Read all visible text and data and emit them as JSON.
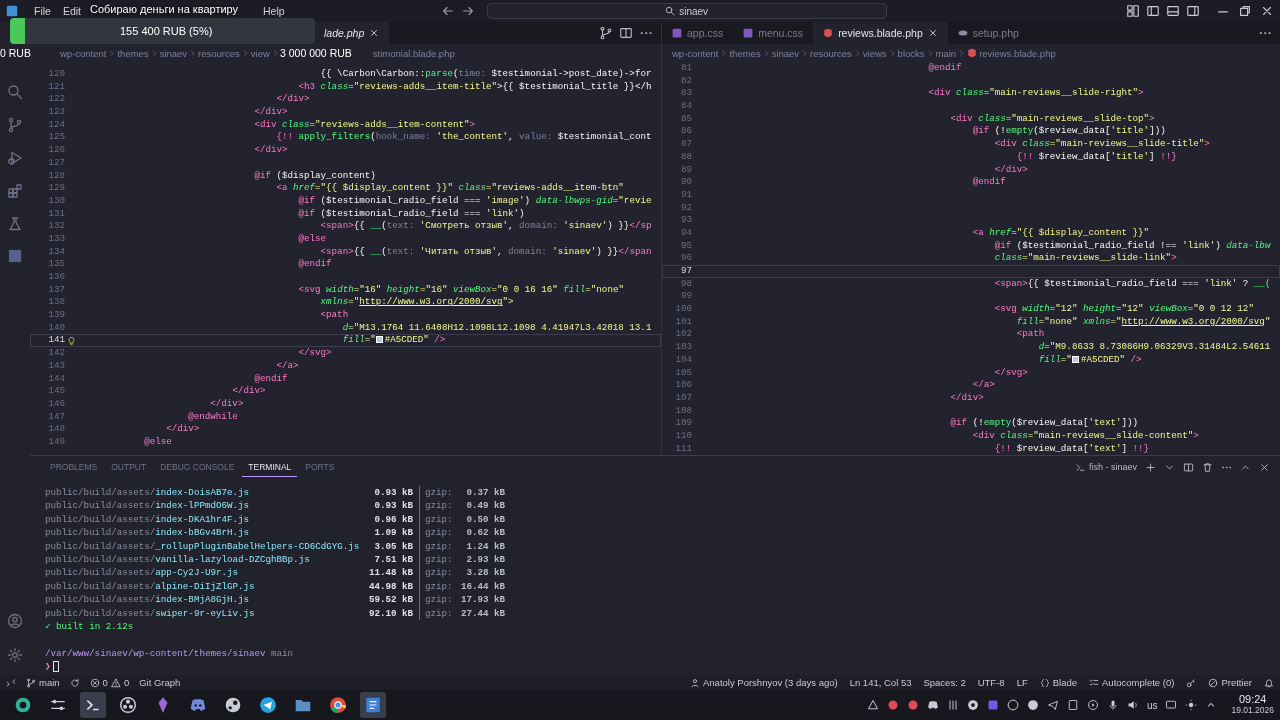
{
  "title_bar": {
    "menu": [
      "File",
      "Edit",
      "Help"
    ],
    "search": {
      "value": "sinaev"
    }
  },
  "donation_overlay": {
    "title": "Собираю деньги на квартиру",
    "level": 0.05,
    "raised": "155 400 RUB (5%)",
    "min_label": "0 RUB",
    "goal_label": "3 000 000 RUB"
  },
  "editors": [
    {
      "tabs": [
        {
          "label": "lade.php",
          "kind": "preview",
          "selected": true
        }
      ],
      "breadcrumbs": [
        "wp-content",
        "themes",
        "sinaev",
        "resources",
        "view"
      ],
      "breadcrumb_file": "stimonial.blade.php",
      "lightbulb": true,
      "lines": [
        {
          "number": "120",
          "current": false,
          "code": [
            {
              "text": "                                            {{ \\Carbon\\Carbon::",
              "kind": "plain"
            },
            {
              "text": "parse",
              "kind": "fn"
            },
            {
              "text": "(",
              "kind": "plain"
            },
            {
              "text": "time: ",
              "kind": "hint"
            },
            {
              "text": "$testimonial->post_date)->for",
              "kind": "plain"
            }
          ]
        },
        {
          "number": "121",
          "current": false,
          "code": [
            {
              "text": "                                        <h3 ",
              "kind": "tag"
            },
            {
              "text": "class",
              "kind": "attr"
            },
            {
              "text": "=\"reviews-adds__item-title\"",
              "kind": "str"
            },
            {
              "text": ">{{ $testimonial_title }}</h",
              "kind": "plain"
            }
          ]
        },
        {
          "number": "122",
          "current": false,
          "code": [
            {
              "text": "                                    </div>",
              "kind": "tag"
            }
          ]
        },
        {
          "number": "123",
          "current": false,
          "code": [
            {
              "text": "                                </div>",
              "kind": "tag"
            }
          ]
        },
        {
          "number": "124",
          "current": false,
          "code": [
            {
              "text": "                                <div ",
              "kind": "tag"
            },
            {
              "text": "class",
              "kind": "attr"
            },
            {
              "text": "=\"reviews-adds__item-content\"",
              "kind": "str"
            },
            {
              "text": ">",
              "kind": "tag"
            }
          ]
        },
        {
          "number": "125",
          "current": false,
          "code": [
            {
              "text": "                                    {!! ",
              "kind": "punct"
            },
            {
              "text": "apply_filters",
              "kind": "fn"
            },
            {
              "text": "(",
              "kind": "plain"
            },
            {
              "text": "hook_name: ",
              "kind": "hint"
            },
            {
              "text": "'the_content'",
              "kind": "str"
            },
            {
              "text": ", ",
              "kind": "plain"
            },
            {
              "text": "value: ",
              "kind": "hint"
            },
            {
              "text": "$testimonial_cont",
              "kind": "plain"
            }
          ]
        },
        {
          "number": "126",
          "current": false,
          "code": [
            {
              "text": "                                </div>",
              "kind": "tag"
            }
          ]
        },
        {
          "number": "127",
          "current": false
        },
        {
          "number": "128",
          "current": false,
          "code": [
            {
              "text": "                                @if",
              "kind": "kw"
            },
            {
              "text": " ($display_content)",
              "kind": "plain"
            }
          ]
        },
        {
          "number": "129",
          "current": false,
          "code": [
            {
              "text": "                                    <a ",
              "kind": "tag"
            },
            {
              "text": "href",
              "kind": "attr"
            },
            {
              "text": "=\"{{ $display_content }}\" ",
              "kind": "str"
            },
            {
              "text": "class",
              "kind": "attr"
            },
            {
              "text": "=\"reviews-adds__item-btn\"",
              "kind": "str"
            }
          ]
        },
        {
          "number": "130",
          "current": false,
          "code": [
            {
              "text": "                                        @if",
              "kind": "kw"
            },
            {
              "text": " ($testimonial_radio_field === ",
              "kind": "plain"
            },
            {
              "text": "'image'",
              "kind": "str"
            },
            {
              "text": ") ",
              "kind": "plain"
            },
            {
              "text": "data-lbwps-gid",
              "kind": "attr"
            },
            {
              "text": "=\"revie",
              "kind": "str"
            }
          ]
        },
        {
          "number": "131",
          "current": false,
          "code": [
            {
              "text": "                                        @if",
              "kind": "kw"
            },
            {
              "text": " ($testimonial_radio_field === ",
              "kind": "plain"
            },
            {
              "text": "'link'",
              "kind": "str"
            },
            {
              "text": ")",
              "kind": "plain"
            }
          ]
        },
        {
          "number": "132",
          "current": false,
          "code": [
            {
              "text": "                                            <span>",
              "kind": "tag"
            },
            {
              "text": "{{ ",
              "kind": "plain"
            },
            {
              "text": "__",
              "kind": "fn"
            },
            {
              "text": "(",
              "kind": "plain"
            },
            {
              "text": "text: ",
              "kind": "hint"
            },
            {
              "text": "'Смотреть отзыв'",
              "kind": "str"
            },
            {
              "text": ", ",
              "kind": "plain"
            },
            {
              "text": "domain: ",
              "kind": "hint"
            },
            {
              "text": "'sinaev'",
              "kind": "str"
            },
            {
              "text": ") }}",
              "kind": "plain"
            },
            {
              "text": "</sp",
              "kind": "tag"
            }
          ]
        },
        {
          "number": "133",
          "current": false,
          "code": [
            {
              "text": "                                        @else",
              "kind": "kw"
            }
          ]
        },
        {
          "number": "134",
          "current": false,
          "code": [
            {
              "text": "                                            <span>",
              "kind": "tag"
            },
            {
              "text": "{{ ",
              "kind": "plain"
            },
            {
              "text": "__",
              "kind": "fn"
            },
            {
              "text": "(",
              "kind": "plain"
            },
            {
              "text": "text: ",
              "kind": "hint"
            },
            {
              "text": "'Читать отзыв'",
              "kind": "str"
            },
            {
              "text": ", ",
              "kind": "plain"
            },
            {
              "text": "domain: ",
              "kind": "hint"
            },
            {
              "text": "'sinaev'",
              "kind": "str"
            },
            {
              "text": ") }}",
              "kind": "plain"
            },
            {
              "text": "</span",
              "kind": "tag"
            }
          ]
        },
        {
          "number": "135",
          "current": false,
          "code": [
            {
              "text": "                                        @endif",
              "kind": "kw"
            }
          ]
        },
        {
          "number": "136",
          "current": false
        },
        {
          "number": "137",
          "current": false,
          "code": [
            {
              "text": "                                        <svg ",
              "kind": "tag"
            },
            {
              "text": "width",
              "kind": "attr"
            },
            {
              "text": "=\"16\" ",
              "kind": "str"
            },
            {
              "text": "height",
              "kind": "attr"
            },
            {
              "text": "=\"16\" ",
              "kind": "str"
            },
            {
              "text": "viewBox",
              "kind": "attr"
            },
            {
              "text": "=\"0 0 16 16\" ",
              "kind": "str"
            },
            {
              "text": "fill",
              "kind": "attr"
            },
            {
              "text": "=\"none\"",
              "kind": "str"
            }
          ]
        },
        {
          "number": "138",
          "current": false,
          "code": [
            {
              "text": "                                            xmlns",
              "kind": "attr"
            },
            {
              "text": "=\"",
              "kind": "str"
            },
            {
              "text": "http://www.w3.org/2000/svg",
              "kind": "url"
            },
            {
              "text": "\">",
              "kind": "str"
            }
          ]
        },
        {
          "number": "139",
          "current": false,
          "code": [
            {
              "text": "                                            <path",
              "kind": "tag"
            }
          ]
        },
        {
          "number": "140",
          "current": false,
          "code": [
            {
              "text": "                                                d",
              "kind": "attr"
            },
            {
              "text": "=\"M13.1764 11.6408H12.1098L12.1098 4.41947L3.42018 13.1",
              "kind": "str"
            }
          ]
        },
        {
          "number": "141",
          "current": true,
          "code": [
            {
              "text": "                                                fill",
              "kind": "attr"
            },
            {
              "text": "=\"",
              "kind": "str"
            },
            {
              "text": "#A5CDED\"",
              "kind": "hex"
            },
            {
              "text": " />",
              "kind": "tag"
            }
          ]
        },
        {
          "number": "142",
          "current": false,
          "code": [
            {
              "text": "                                        </svg>",
              "kind": "tag"
            }
          ]
        },
        {
          "number": "143",
          "current": false,
          "code": [
            {
              "text": "                                    </a>",
              "kind": "tag"
            }
          ]
        },
        {
          "number": "144",
          "current": false,
          "code": [
            {
              "text": "                                @endif",
              "kind": "kw"
            }
          ]
        },
        {
          "number": "145",
          "current": false,
          "code": [
            {
              "text": "                            </div>",
              "kind": "tag"
            }
          ]
        },
        {
          "number": "146",
          "current": false,
          "code": [
            {
              "text": "                        </div>",
              "kind": "tag"
            }
          ]
        },
        {
          "number": "147",
          "current": false,
          "code": [
            {
              "text": "                    @endwhile",
              "kind": "kw"
            }
          ]
        },
        {
          "number": "148",
          "current": false,
          "code": [
            {
              "text": "                </div>",
              "kind": "tag"
            }
          ]
        },
        {
          "number": "149",
          "current": false,
          "code": [
            {
              "text": "            @else",
              "kind": "kw"
            }
          ]
        }
      ]
    },
    {
      "tabs": [
        {
          "label": "app.css",
          "kind": "css",
          "selected": false
        },
        {
          "label": "menu.css",
          "kind": "css",
          "selected": false
        },
        {
          "label": "reviews.blade.php",
          "kind": "blade",
          "selected": true
        },
        {
          "label": "setup.php",
          "kind": "php",
          "selected": false
        }
      ],
      "breadcrumbs": [
        "wp-content",
        "themes",
        "sinaev",
        "resources",
        "views",
        "blocks",
        "main"
      ],
      "breadcrumb_file": "reviews.blade.php",
      "lines": [
        {
          "number": "81",
          "current": false,
          "code": [
            {
              "text": "                                        @endif",
              "kind": "kw"
            }
          ]
        },
        {
          "number": "82",
          "current": false
        },
        {
          "number": "83",
          "current": false,
          "code": [
            {
              "text": "                                        <div ",
              "kind": "tag"
            },
            {
              "text": "class",
              "kind": "attr"
            },
            {
              "text": "=\"main-reviews__slide-right\"",
              "kind": "str"
            },
            {
              "text": ">",
              "kind": "tag"
            }
          ]
        },
        {
          "number": "84",
          "current": false
        },
        {
          "number": "85",
          "current": false,
          "code": [
            {
              "text": "                                            <div ",
              "kind": "tag"
            },
            {
              "text": "class",
              "kind": "attr"
            },
            {
              "text": "=\"main-reviews__slide-top\"",
              "kind": "str"
            },
            {
              "text": ">",
              "kind": "tag"
            }
          ]
        },
        {
          "number": "86",
          "current": false,
          "code": [
            {
              "text": "                                                @if",
              "kind": "kw"
            },
            {
              "text": " (!",
              "kind": "plain"
            },
            {
              "text": "empty",
              "kind": "fn"
            },
            {
              "text": "($review_data[",
              "kind": "plain"
            },
            {
              "text": "'title'",
              "kind": "str"
            },
            {
              "text": "]))",
              "kind": "plain"
            }
          ]
        },
        {
          "number": "87",
          "current": false,
          "code": [
            {
              "text": "                                                    <div ",
              "kind": "tag"
            },
            {
              "text": "class",
              "kind": "attr"
            },
            {
              "text": "=\"main-reviews__slide-title\"",
              "kind": "str"
            },
            {
              "text": ">",
              "kind": "tag"
            }
          ]
        },
        {
          "number": "88",
          "current": false,
          "code": [
            {
              "text": "                                                        {!!",
              "kind": "punct"
            },
            {
              "text": " $review_data[",
              "kind": "plain"
            },
            {
              "text": "'title'",
              "kind": "str"
            },
            {
              "text": "] ",
              "kind": "plain"
            },
            {
              "text": "!!}",
              "kind": "punct"
            }
          ]
        },
        {
          "number": "89",
          "current": false,
          "code": [
            {
              "text": "                                                    </div>",
              "kind": "tag"
            }
          ]
        },
        {
          "number": "90",
          "current": false,
          "code": [
            {
              "text": "                                                @endif",
              "kind": "kw"
            }
          ]
        },
        {
          "number": "91",
          "current": false
        },
        {
          "number": "92",
          "current": false
        },
        {
          "number": "93",
          "current": false
        },
        {
          "number": "94",
          "current": false,
          "code": [
            {
              "text": "                                                <a ",
              "kind": "tag"
            },
            {
              "text": "href",
              "kind": "attr"
            },
            {
              "text": "=\"{{ $display_content }}\"",
              "kind": "str"
            }
          ]
        },
        {
          "number": "95",
          "current": false,
          "code": [
            {
              "text": "                                                    @if",
              "kind": "kw"
            },
            {
              "text": " ($testimonial_radio_field !== ",
              "kind": "plain"
            },
            {
              "text": "'link'",
              "kind": "str"
            },
            {
              "text": ") ",
              "kind": "plain"
            },
            {
              "text": "data-lbw",
              "kind": "attr"
            }
          ]
        },
        {
          "number": "96",
          "current": false,
          "code": [
            {
              "text": "                                                    class",
              "kind": "attr"
            },
            {
              "text": "=\"main-reviews__slide-link\"",
              "kind": "str"
            },
            {
              "text": ">",
              "kind": "tag"
            }
          ]
        },
        {
          "number": "97",
          "current": true
        },
        {
          "number": "98",
          "current": false,
          "code": [
            {
              "text": "                                                    <span>",
              "kind": "tag"
            },
            {
              "text": "{{ $testimonial_radio_field === ",
              "kind": "plain"
            },
            {
              "text": "'link'",
              "kind": "str"
            },
            {
              "text": " ? ",
              "kind": "plain"
            },
            {
              "text": "__(",
              "kind": "fn"
            }
          ]
        },
        {
          "number": "99",
          "current": false
        },
        {
          "number": "100",
          "current": false,
          "code": [
            {
              "text": "                                                    <svg ",
              "kind": "tag"
            },
            {
              "text": "width",
              "kind": "attr"
            },
            {
              "text": "=\"12\" ",
              "kind": "str"
            },
            {
              "text": "height",
              "kind": "attr"
            },
            {
              "text": "=\"12\" ",
              "kind": "str"
            },
            {
              "text": "viewBox",
              "kind": "attr"
            },
            {
              "text": "=\"0 0 12 12\"",
              "kind": "str"
            }
          ]
        },
        {
          "number": "101",
          "current": false,
          "code": [
            {
              "text": "                                                        fill",
              "kind": "attr"
            },
            {
              "text": "=\"none\" ",
              "kind": "str"
            },
            {
              "text": "xmlns",
              "kind": "attr"
            },
            {
              "text": "=\"",
              "kind": "str"
            },
            {
              "text": "http://www.w3.org/2000/svg",
              "kind": "url"
            },
            {
              "text": "\"",
              "kind": "str"
            }
          ]
        },
        {
          "number": "102",
          "current": false,
          "code": [
            {
              "text": "                                                        <path",
              "kind": "tag"
            }
          ]
        },
        {
          "number": "103",
          "current": false,
          "code": [
            {
              "text": "                                                            d",
              "kind": "attr"
            },
            {
              "text": "=\"M9.8633 8.73086H9.06329V3.31484L2.54611",
              "kind": "str"
            }
          ]
        },
        {
          "number": "104",
          "current": false,
          "code": [
            {
              "text": "                                                            fill",
              "kind": "attr"
            },
            {
              "text": "=\"",
              "kind": "str"
            },
            {
              "text": "#A5CDED\"",
              "kind": "hex"
            },
            {
              "text": " />",
              "kind": "tag"
            }
          ]
        },
        {
          "number": "105",
          "current": false,
          "code": [
            {
              "text": "                                                    </svg>",
              "kind": "tag"
            }
          ]
        },
        {
          "number": "106",
          "current": false,
          "code": [
            {
              "text": "                                                </a>",
              "kind": "tag"
            }
          ]
        },
        {
          "number": "107",
          "current": false,
          "code": [
            {
              "text": "                                            </div>",
              "kind": "tag"
            }
          ]
        },
        {
          "number": "108",
          "current": false
        },
        {
          "number": "109",
          "current": false,
          "code": [
            {
              "text": "                                            @if",
              "kind": "kw"
            },
            {
              "text": " (!",
              "kind": "plain"
            },
            {
              "text": "empty",
              "kind": "fn"
            },
            {
              "text": "($review_data[",
              "kind": "plain"
            },
            {
              "text": "'text'",
              "kind": "str"
            },
            {
              "text": "]))",
              "kind": "plain"
            }
          ]
        },
        {
          "number": "110",
          "current": false,
          "code": [
            {
              "text": "                                                <div ",
              "kind": "tag"
            },
            {
              "text": "class",
              "kind": "attr"
            },
            {
              "text": "=\"main-reviews__slide-content\"",
              "kind": "str"
            },
            {
              "text": ">",
              "kind": "tag"
            }
          ]
        },
        {
          "number": "111",
          "current": false,
          "code": [
            {
              "text": "                                                    {!!",
              "kind": "punct"
            },
            {
              "text": " $review_data[",
              "kind": "plain"
            },
            {
              "text": "'text'",
              "kind": "str"
            },
            {
              "text": "] ",
              "kind": "plain"
            },
            {
              "text": "!!}",
              "kind": "punct"
            }
          ]
        }
      ]
    }
  ],
  "panel": {
    "tabs": [
      {
        "label": "PROBLEMS",
        "selected": false
      },
      {
        "label": "OUTPUT",
        "selected": false
      },
      {
        "label": "DEBUG CONSOLE",
        "selected": false
      },
      {
        "label": "TERMINAL",
        "selected": true
      },
      {
        "label": "PORTS",
        "selected": false
      }
    ],
    "terminal_name": "fish - sinaev",
    "rows": [
      {
        "dir": "public/build/assets/",
        "file": "index-DoisAB7e.js",
        "size": "0.93 kB",
        "gzip_label": "gzip:",
        "gzip": "0.37 kB"
      },
      {
        "dir": "public/build/assets/",
        "file": "index-lPPmdO6W.js",
        "size": "0.93 kB",
        "gzip_label": "gzip:",
        "gzip": "0.49 kB"
      },
      {
        "dir": "public/build/assets/",
        "file": "index-DKA1hr4F.js",
        "size": "0.96 kB",
        "gzip_label": "gzip:",
        "gzip": "0.50 kB"
      },
      {
        "dir": "public/build/assets/",
        "file": "index-bBGv4BrH.js",
        "size": "1.09 kB",
        "gzip_label": "gzip:",
        "gzip": "0.62 kB"
      },
      {
        "dir": "public/build/assets/",
        "file": "_rollupPluginBabelHelpers-CD6CdGYG.js",
        "size": "3.05 kB",
        "gzip_label": "gzip:",
        "gzip": "1.24 kB"
      },
      {
        "dir": "public/build/assets/",
        "file": "vanilla-lazyload-DZCghBBp.js",
        "size": "7.51 kB",
        "gzip_label": "gzip:",
        "gzip": "2.93 kB"
      },
      {
        "dir": "public/build/assets/",
        "file": "app-Cy2J-U9r.js",
        "size": "11.48 kB",
        "gzip_label": "gzip:",
        "gzip": "3.28 kB"
      },
      {
        "dir": "public/build/assets/",
        "file": "alpine-DiIjZlGP.js",
        "size": "44.98 kB",
        "gzip_label": "gzip:",
        "gzip": "16.44 kB"
      },
      {
        "dir": "public/build/assets/",
        "file": "index-BMjA8GjH.js",
        "size": "59.52 kB",
        "gzip_label": "gzip:",
        "gzip": "17.93 kB"
      },
      {
        "dir": "public/build/assets/",
        "file": "swiper-9r-eyLiv.js",
        "size": "92.10 kB",
        "gzip_label": "gzip:",
        "gzip": "27.44 kB"
      }
    ],
    "built": "✓ built in 2.12s",
    "cwd": "/var/www/sinaev/wp-content/themes/sinaev",
    "cwd_branch": "main",
    "prompt": "❯"
  },
  "status_bar": {
    "branch": "main",
    "errors": "0",
    "warnings": "0",
    "git_graph": "Git Graph",
    "blame": "Anatoly Porshnyov (3 days ago)",
    "cursor": "Ln 141, Col 53",
    "indentation": "Spaces: 2",
    "encoding": "UTF-8",
    "eol": "LF",
    "language": "Blade",
    "autocomplete": "Autocomplete (0)",
    "prettier": "Prettier"
  },
  "taskbar": {
    "apps": [
      {
        "kind": "launcher",
        "active": false
      },
      {
        "kind": "mixer",
        "active": false
      },
      {
        "kind": "terminal",
        "active": true
      },
      {
        "kind": "obs",
        "active": false
      },
      {
        "kind": "crystal",
        "active": false
      },
      {
        "kind": "discord",
        "active": false
      },
      {
        "kind": "steam",
        "active": false
      },
      {
        "kind": "telegram",
        "active": false
      },
      {
        "kind": "files",
        "active": false
      },
      {
        "kind": "chrome",
        "active": false
      },
      {
        "kind": "editor",
        "active": true
      }
    ],
    "keyboard": "us",
    "time": "09:24",
    "date": "19.01.2026"
  }
}
